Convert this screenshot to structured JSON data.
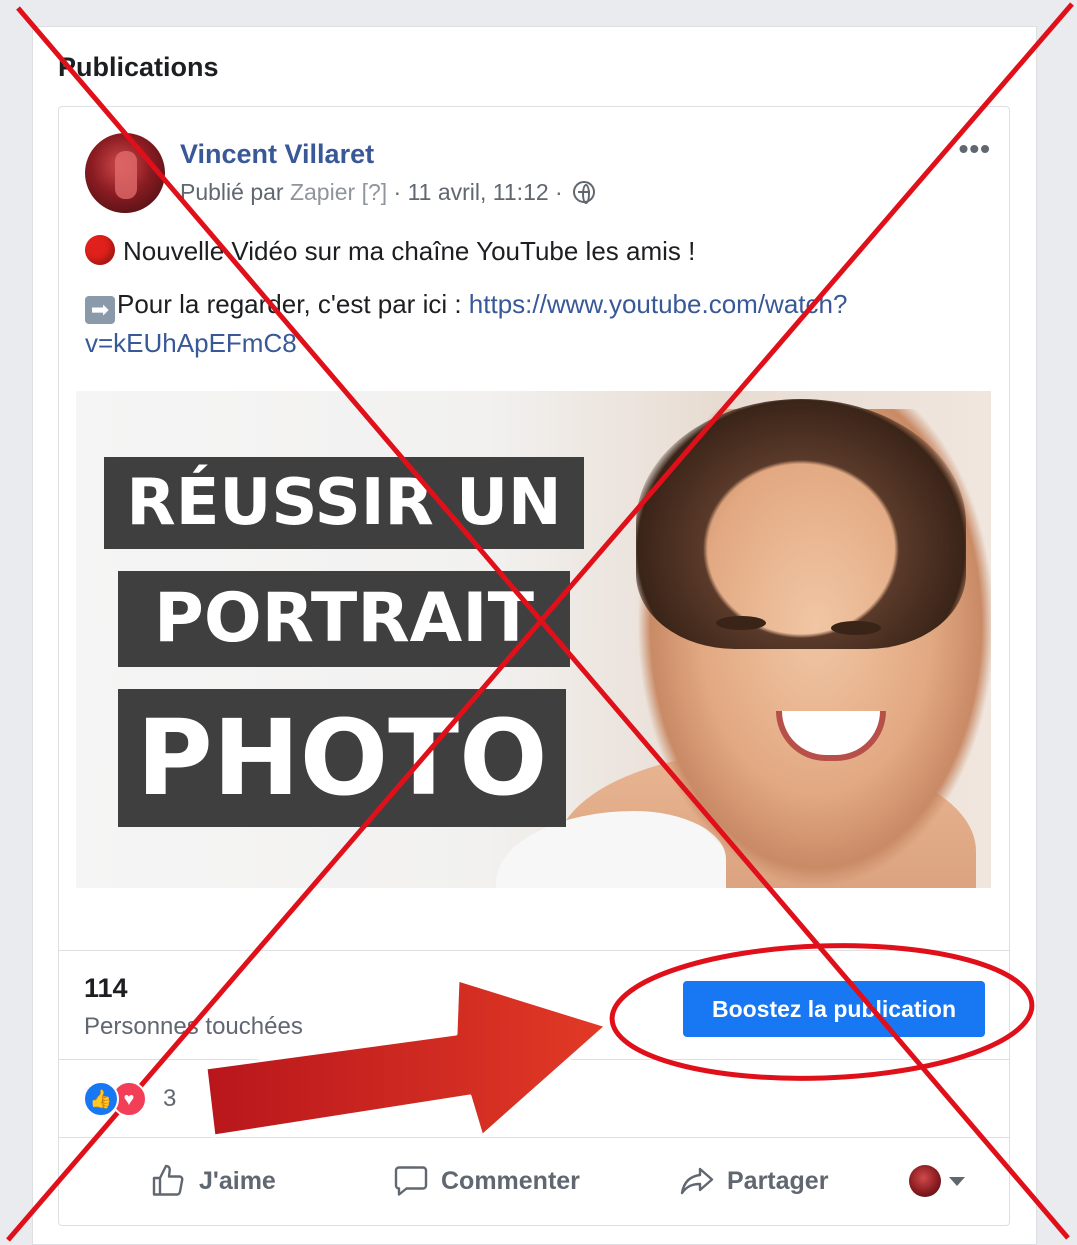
{
  "section": {
    "title": "Publications"
  },
  "post": {
    "author": "Vincent Villaret",
    "published_by_prefix": "Publié par",
    "published_by_app": "Zapier",
    "help_marker": "[?]",
    "date": "· 11 avril, 11:12 ·",
    "more_label": "•••",
    "line1": "Nouvelle Vidéo sur ma chaîne YouTube les amis !",
    "line2_prefix": "Pour la regarder, c'est par ici : ",
    "link": "https://www.youtube.com/watch?v=kEUhApEFmC8",
    "thumbnail": {
      "line1": "RÉUSSIR UN",
      "line2": "PORTRAIT",
      "line3": "PHOTO"
    }
  },
  "insights": {
    "reach_value": "114",
    "reach_label": "Personnes touchées",
    "boost_label": "Boostez la publication"
  },
  "reactions": {
    "count": "3",
    "icons": [
      "like-icon",
      "love-icon"
    ]
  },
  "actions": {
    "like": "J'aime",
    "comment": "Commenter",
    "share": "Partager"
  },
  "colors": {
    "author_link": "#385898",
    "boost_button": "#1877f2",
    "annotation_red": "#e0101a"
  }
}
